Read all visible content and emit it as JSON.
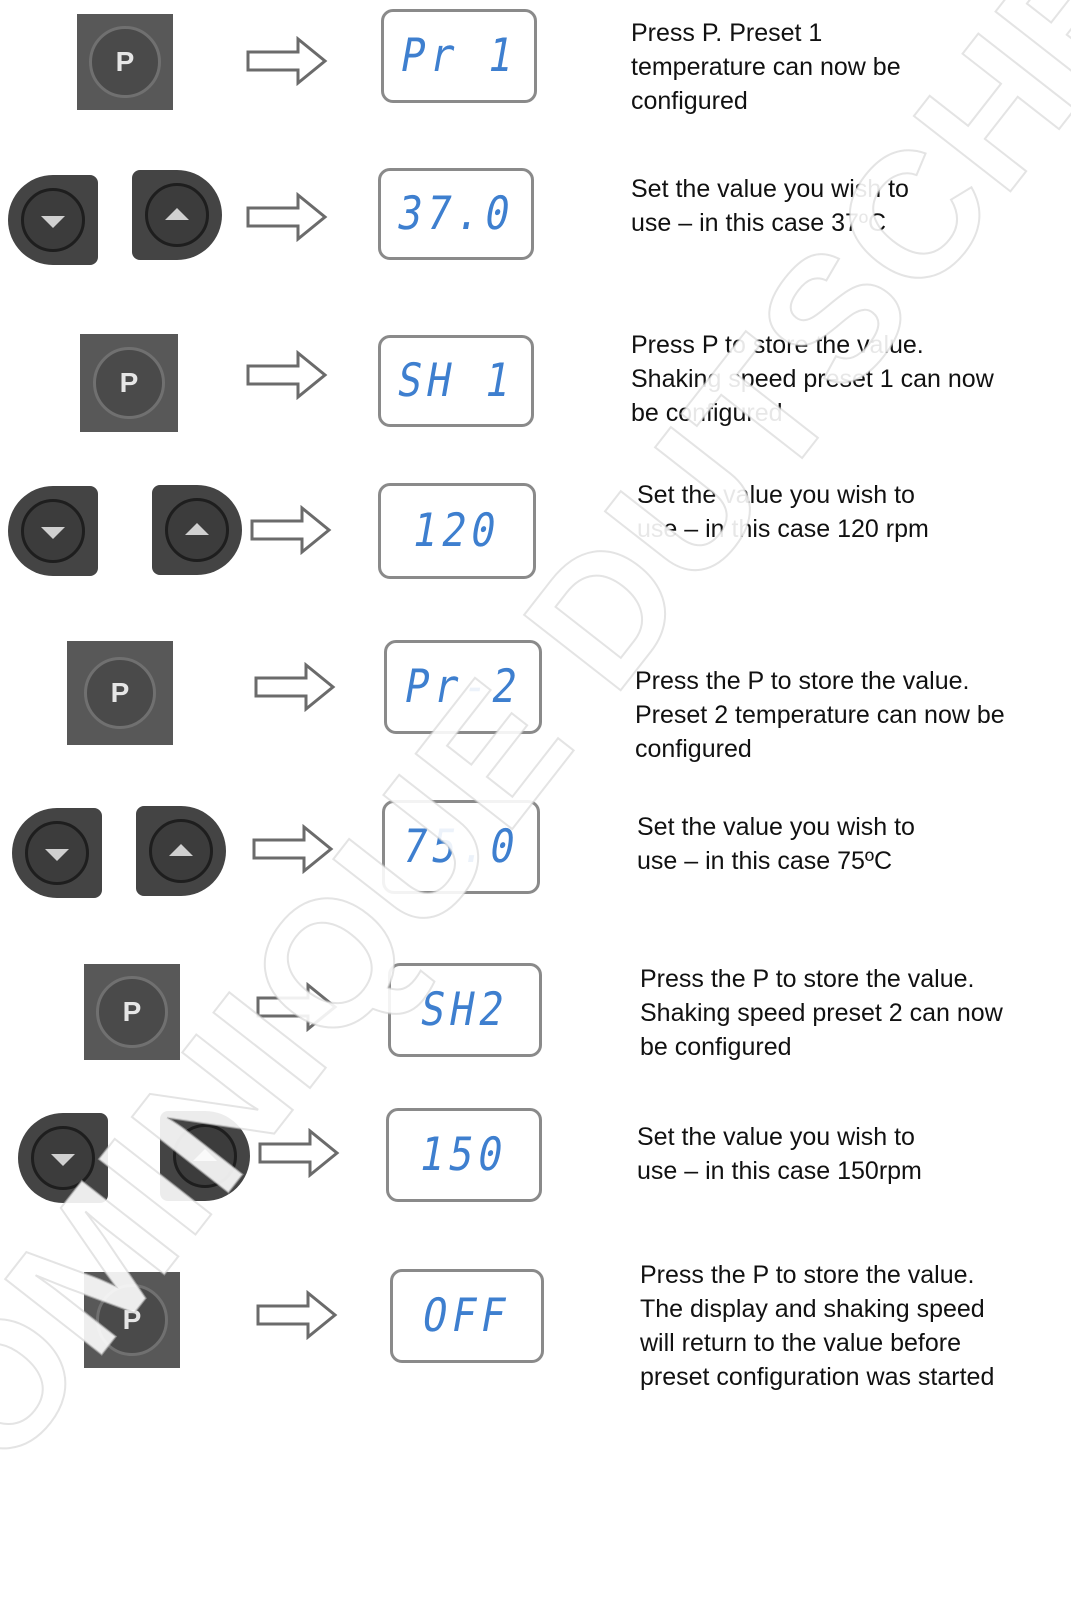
{
  "watermark": "DOMINIQUE DUTSCHER",
  "buttons": {
    "p_label": "P"
  },
  "steps": [
    {
      "display": "Pr 1",
      "lines": [
        "Press P. Preset 1",
        "temperature can now be",
        "configured"
      ]
    },
    {
      "display": "37.0",
      "lines": [
        "Set the value you wish to",
        "use – in this case 37ºC"
      ]
    },
    {
      "display": "SH 1",
      "lines": [
        "Press P to store the value.",
        "Shaking speed preset 1 can now",
        "be configured"
      ]
    },
    {
      "display": "120",
      "lines": [
        "Set the value you wish to",
        "use – in this case 120 rpm"
      ]
    },
    {
      "display": "Pr-2",
      "lines": [
        "Press the P to store the value.",
        "Preset 2 temperature can now be",
        "configured"
      ]
    },
    {
      "display": "75.0",
      "lines": [
        "Set the value you wish to",
        "use – in this case 75ºC"
      ]
    },
    {
      "display": "SH2",
      "lines": [
        "Press the P to store the value.",
        "Shaking speed preset 2 can now",
        "be configured"
      ]
    },
    {
      "display": "150",
      "lines": [
        "Set the value you wish to",
        "use – in this case 150rpm"
      ]
    },
    {
      "display": "OFF",
      "lines": [
        "Press the P to store the value.",
        "The display and shaking speed",
        "will return to the value before",
        "preset configuration was started"
      ]
    }
  ],
  "colors": {
    "lcd_text": "#3e7fcf",
    "lcd_border": "#8a8a8a",
    "button_dark": "#444444",
    "p_button": "#585858"
  }
}
